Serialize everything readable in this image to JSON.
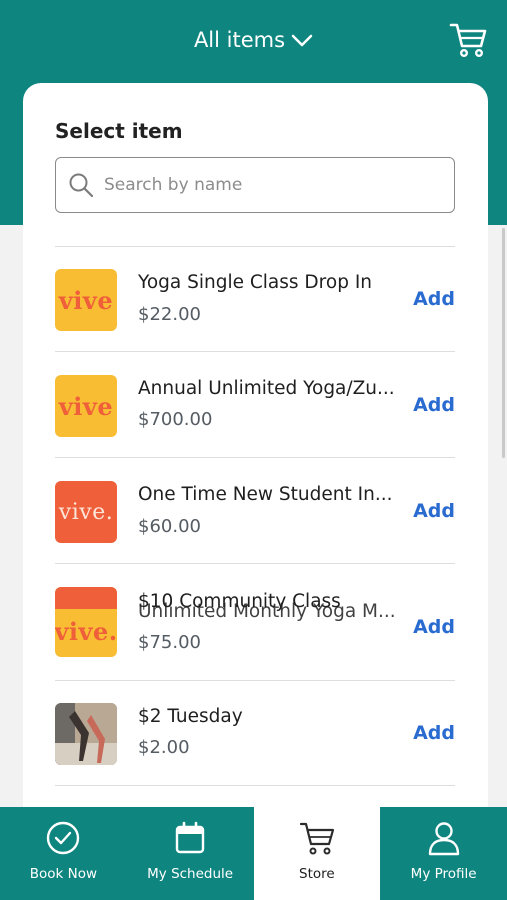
{
  "header": {
    "title": "All items",
    "icons": {
      "dropdown": "chevron-down-icon",
      "cart": "cart-icon"
    }
  },
  "card": {
    "title": "Select item",
    "search": {
      "placeholder": "Search by name",
      "value": ""
    }
  },
  "items": [
    {
      "name": "Yoga Single Class Drop In",
      "price": "$22.00",
      "add_label": "Add",
      "thumb_text": "vive"
    },
    {
      "name": "Annual Unlimited Yoga/Zu...",
      "price": "$700.00",
      "add_label": "Add",
      "thumb_text": "vive"
    },
    {
      "name": "One Time New Student In...",
      "price": "$60.00",
      "add_label": "Add",
      "thumb_text": "vive."
    },
    {
      "name": "Unlimited Monthly Yoga M...",
      "overlay_name": "$10 Community Class",
      "price": "$75.00",
      "add_label": "Add",
      "thumb_text": "vive."
    },
    {
      "name": "$2 Tuesday",
      "price": "$2.00",
      "add_label": "Add"
    }
  ],
  "nav": [
    {
      "label": "Book Now",
      "icon": "check-circle-icon"
    },
    {
      "label": "My Schedule",
      "icon": "calendar-icon"
    },
    {
      "label": "Store",
      "icon": "cart-icon",
      "active": true
    },
    {
      "label": "My Profile",
      "icon": "person-icon"
    }
  ],
  "colors": {
    "brand_teal": "#0f8580",
    "accent_blue": "#2a6bd0",
    "vive_yellow": "#f8bd33",
    "vive_orange": "#ee5f3a"
  }
}
